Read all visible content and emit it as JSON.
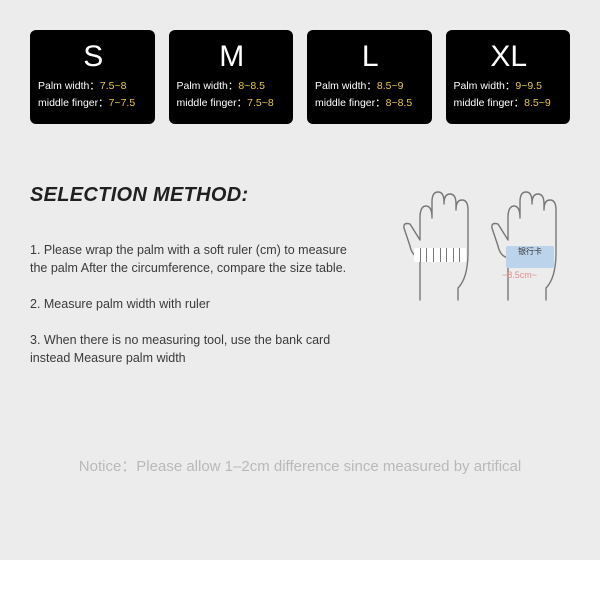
{
  "sizes": [
    {
      "letter": "S",
      "palm_label": "Palm width：",
      "palm_val": "7.5~8",
      "finger_label": "middle finger：",
      "finger_val": "7~7.5"
    },
    {
      "letter": "M",
      "palm_label": "Palm width：",
      "palm_val": "8~8.5",
      "finger_label": "middle finger：",
      "finger_val": "7.5~8"
    },
    {
      "letter": "L",
      "palm_label": "Palm width：",
      "palm_val": "8.5~9",
      "finger_label": "middle finger：",
      "finger_val": "8~8.5"
    },
    {
      "letter": "XL",
      "palm_label": "Palm width：",
      "palm_val": "9~9.5",
      "finger_label": "middle finger：",
      "finger_val": "8.5~9"
    }
  ],
  "heading": "SELECTION METHOD:",
  "steps": [
    "1. Please wrap the palm with a soft ruler (cm) to measure the palm After the circumference, compare the size table.",
    "2. Measure palm width with ruler",
    "3. When there is no measuring tool, use the bank card instead Measure palm width"
  ],
  "bank_card_text": "银行卡",
  "measure_text": "~8.5cm~",
  "notice": "Notice：Please allow 1–2cm difference since measured by artifical"
}
